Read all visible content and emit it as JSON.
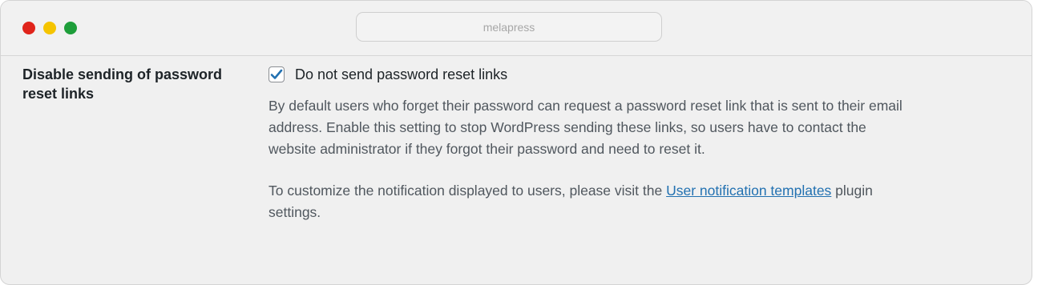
{
  "window": {
    "url": "melapress",
    "traffic_lights": {
      "close_color": "#e0241b",
      "minimize_color": "#f5c400",
      "maximize_color": "#1e9e3a"
    }
  },
  "setting": {
    "title": "Disable sending of password reset links",
    "checkbox": {
      "label": "Do not send password reset links",
      "checked": true,
      "check_color": "#2271b1"
    },
    "description": "By default users who forget their password can request a password reset link that is sent to their email address. Enable this setting to stop WordPress sending these links, so users have to contact the website administrator if they forgot their password and need to reset it.",
    "notice": {
      "prefix": "To customize the notification displayed to users, please visit the ",
      "link_text": "User notification templates",
      "suffix": " plugin settings."
    }
  },
  "colors": {
    "link": "#2271b1",
    "description_text": "#50575e",
    "heading_text": "#1d2327"
  }
}
